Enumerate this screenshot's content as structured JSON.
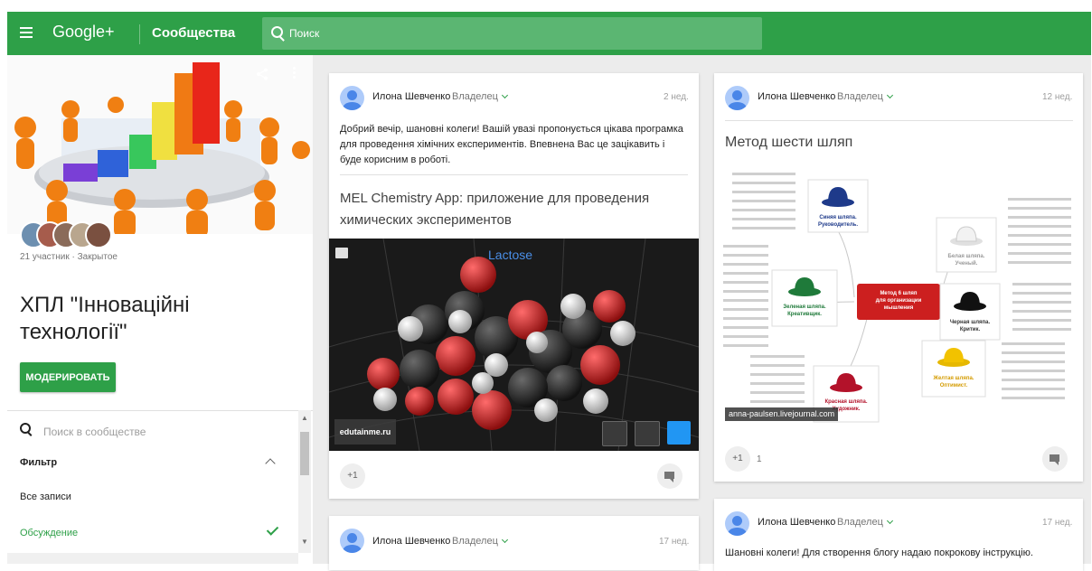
{
  "topbar": {
    "brand": "Google+",
    "section": "Сообщества",
    "search_placeholder": "Поиск"
  },
  "community": {
    "members_line": "21 участник · Закрытое",
    "title_line1": "ХПЛ \"Інноваційні",
    "title_line2": "технології\"",
    "moderate_label": "МОДЕРИРОВАТЬ",
    "search_placeholder": "Поиск в сообществе",
    "filter_label": "Фильтр",
    "filter_all": "Все записи",
    "filter_discussion": "Обсуждение"
  },
  "posts": [
    {
      "author": "Илона Шевченко",
      "role": "Владелец",
      "when": "2 нед.",
      "text": [
        "Добрий вечір, шановні колеги! Вашій увазі пропонується цікава програмка",
        "для проведення  хімічних експериментів. Впевнена Вас це зацікавить і",
        "буде корисним в роботі."
      ],
      "link_title": [
        "MEL Chemistry App: приложение для проведения",
        "химических экспериментов"
      ],
      "image": {
        "label": "Lactose",
        "credit": "edutainme.ru"
      },
      "plus_one": "+1"
    },
    {
      "author": "Илона Шевченко",
      "role": "Владелец",
      "when": "12 нед.",
      "title": "Метод шести шляп",
      "mindmap": {
        "center": [
          "Метод 6 шляп",
          "для организации",
          "мышления"
        ],
        "hats": [
          {
            "name": "Синяя шляпа.",
            "sub": "Руководитель.",
            "color": "#1e3a8a"
          },
          {
            "name": "Белая шляпа.",
            "sub": "Ученый.",
            "color": "#e5e5e5"
          },
          {
            "name": "Зеленая шляпа.",
            "sub": "Креативщик.",
            "color": "#1f7a3a"
          },
          {
            "name": "Черная шляпа.",
            "sub": "Критик.",
            "color": "#111111"
          },
          {
            "name": "Желтая шляпа.",
            "sub": "Оптимист.",
            "color": "#e6b800"
          },
          {
            "name": "Красная шляпа.",
            "sub": "Художник.",
            "color": "#b3122a"
          }
        ],
        "watermark": "anna-paulsen.livejournal.com"
      },
      "plus_one": "+1",
      "plus_count": "1"
    },
    {
      "author": "Илона Шевченко",
      "role": "Владелец",
      "when": "17 нед."
    },
    {
      "author": "Илона Шевченко",
      "role": "Владелец",
      "when": "17 нед.",
      "text": [
        "Шановні колеги! Для створення блогу надаю покрокову інструкцію."
      ]
    }
  ],
  "colors": {
    "accent": "#2ea048",
    "background": "#ececec"
  }
}
